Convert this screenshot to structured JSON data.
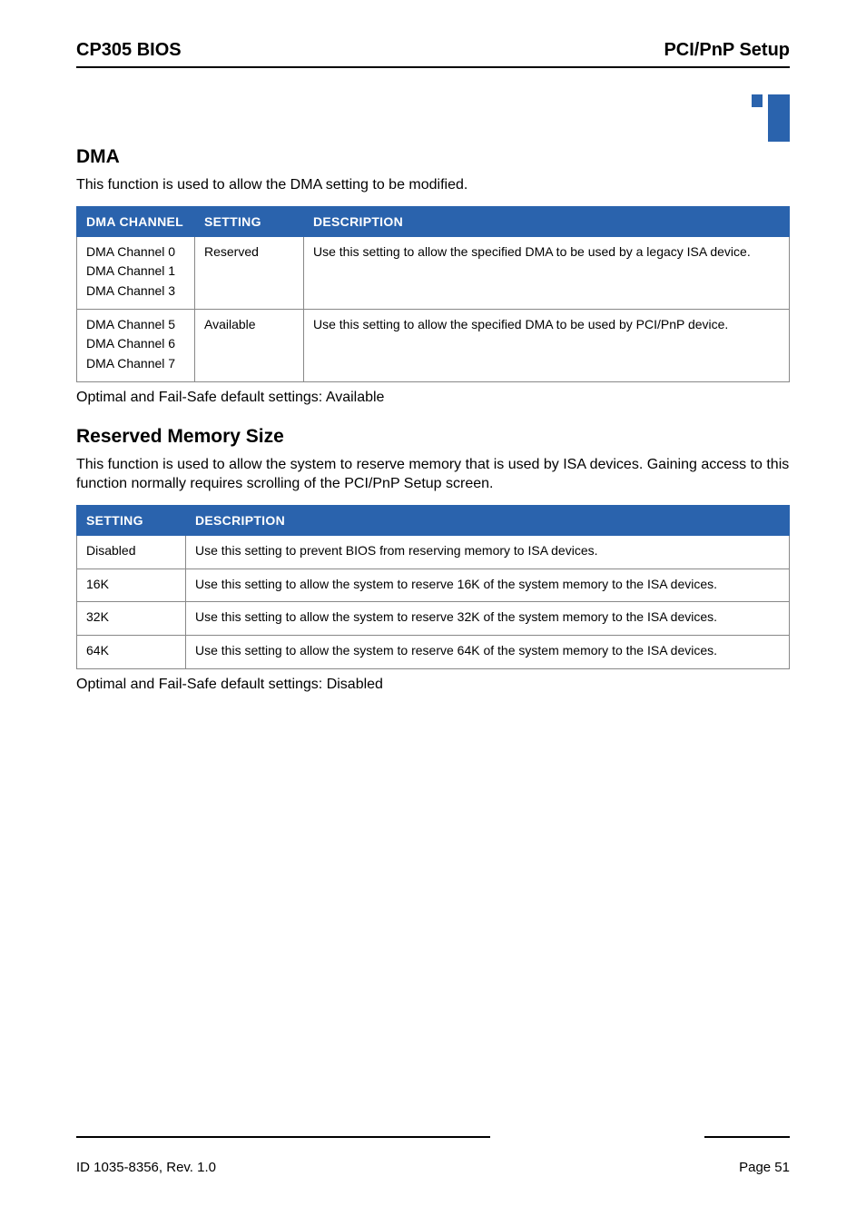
{
  "header": {
    "left": "CP305 BIOS",
    "right": "PCI/PnP Setup"
  },
  "sections": {
    "dma": {
      "title": "DMA",
      "lead": "This function is used to allow the DMA setting to be modified.",
      "headers": {
        "c1": "DMA CHANNEL",
        "c2": "SETTING",
        "c3": "DESCRIPTION"
      },
      "rows": [
        {
          "channels": "DMA Channel 0\nDMA Channel 1\nDMA Channel 3",
          "setting": "Reserved",
          "desc": "Use this setting to allow the specified DMA to be used by a legacy ISA device."
        },
        {
          "channels": "DMA Channel 5\nDMA Channel 6\nDMA Channel 7",
          "setting": "Available",
          "desc": "Use this setting to allow the specified DMA to be used by PCI/PnP device."
        }
      ],
      "note": "Optimal and Fail-Safe default settings: Available"
    },
    "mem": {
      "title": "Reserved Memory Size",
      "lead": "This function is used to allow the system to reserve memory that is used by ISA devices. Gaining access to this function normally requires scrolling of the PCI/PnP Setup screen.",
      "headers": {
        "c1": "SETTING",
        "c2": "DESCRIPTION"
      },
      "rows": [
        {
          "setting": "Disabled",
          "desc": "Use this setting to prevent BIOS from reserving memory to ISA devices."
        },
        {
          "setting": "16K",
          "desc": "Use this setting to allow the system to reserve 16K of the system memory to the ISA devices."
        },
        {
          "setting": "32K",
          "desc": "Use this setting to allow the system to reserve 32K of the system memory to the ISA devices."
        },
        {
          "setting": "64K",
          "desc": "Use this setting to allow the system to reserve 64K of the system memory to the ISA devices."
        }
      ],
      "note": "Optimal and Fail-Safe default settings: Disabled"
    }
  },
  "footer": {
    "left": "ID 1035-8356, Rev. 1.0",
    "right": "Page 51"
  }
}
